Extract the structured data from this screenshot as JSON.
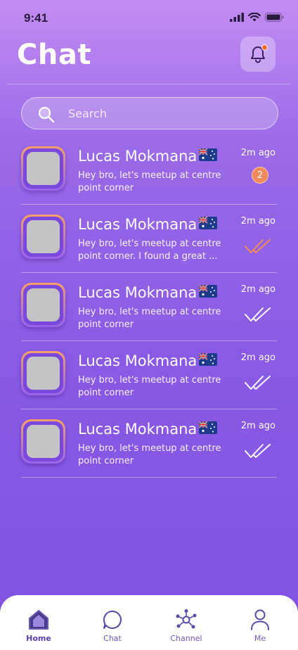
{
  "status_bar": {
    "time": "9:41"
  },
  "header": {
    "title": "Chat"
  },
  "search": {
    "placeholder": "Search"
  },
  "chats": [
    {
      "name": "Lucas Mokmana",
      "preview": "Hey bro, let's meetup at centre point corner",
      "time": "2m ago",
      "unread": "2",
      "read_status": "unread"
    },
    {
      "name": "Lucas Mokmana",
      "preview": "Hey bro, let's meetup at centre point corner. I found a great ...",
      "time": "2m ago",
      "unread": "",
      "read_status": "read"
    },
    {
      "name": "Lucas Mokmana",
      "preview": "Hey bro, let's meetup at centre point corner",
      "time": "2m ago",
      "unread": "",
      "read_status": "delivered"
    },
    {
      "name": "Lucas Mokmana",
      "preview": "Hey bro, let's meetup at centre point corner",
      "time": "2m ago",
      "unread": "",
      "read_status": "delivered"
    },
    {
      "name": "Lucas Mokmana",
      "preview": "Hey bro, let's meetup at centre point corner",
      "time": "2m ago",
      "unread": "",
      "read_status": "delivered"
    }
  ],
  "bottom_nav": [
    {
      "label": "Home",
      "icon": "home-icon",
      "active": true
    },
    {
      "label": "Chat",
      "icon": "chat-bubble-icon",
      "active": false
    },
    {
      "label": "Channel",
      "icon": "channel-network-icon",
      "active": false
    },
    {
      "label": "Me",
      "icon": "user-icon",
      "active": false
    }
  ],
  "colors": {
    "accent": "#8a5ae6",
    "badge": "#f08a5a",
    "read_check": "#f08a5a",
    "nav_text": "#7058c0"
  }
}
